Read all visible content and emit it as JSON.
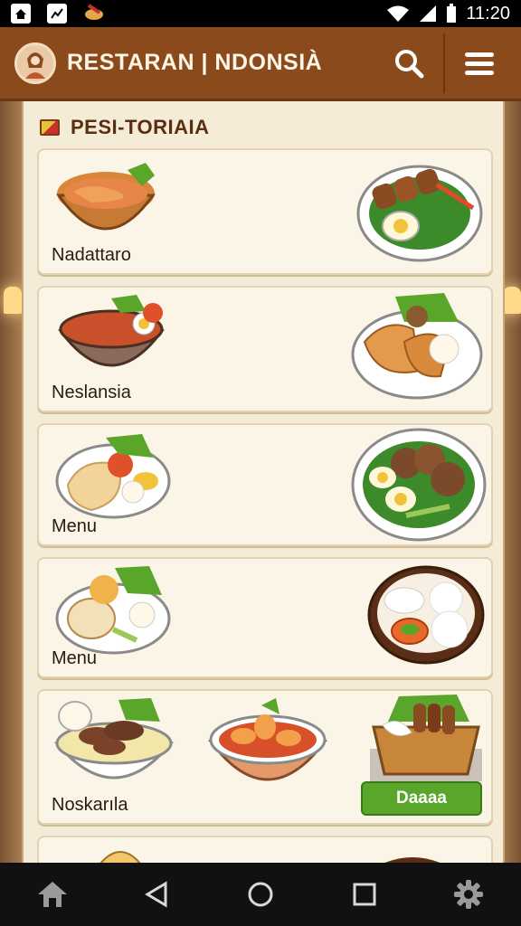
{
  "status_bar": {
    "time": "11:20"
  },
  "app_bar": {
    "title": "RESTARAN | NDONSIÀ"
  },
  "section": {
    "title": "PESI-TORIAIA"
  },
  "cards": [
    {
      "label": "Nadattaro"
    },
    {
      "label": "Neslansia"
    },
    {
      "label": "Menu"
    },
    {
      "label": "Menu"
    },
    {
      "label": "Noskarıla",
      "button": "Daaaa"
    }
  ],
  "colors": {
    "app_bar": "#8b4a1c",
    "panel": "#f5ecd8",
    "accent_button": "#5aa62b"
  },
  "icons": [
    "search-icon",
    "menu-icon",
    "back-icon",
    "home-icon",
    "recents-icon",
    "settings-icon"
  ]
}
